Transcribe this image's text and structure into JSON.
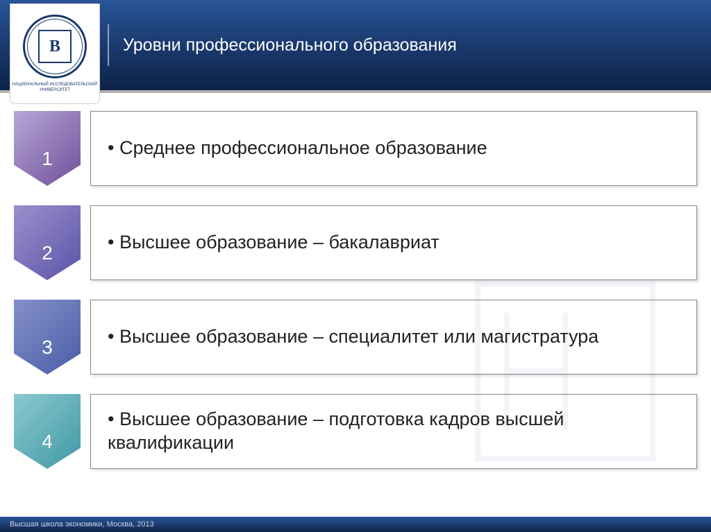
{
  "header": {
    "title": "Уровни профессионального образования"
  },
  "logo": {
    "initials": "В",
    "line1": "НАЦИОНАЛЬНЫЙ ИССЛЕДОВАТЕЛЬСКИЙ",
    "line2": "УНИВЕРСИТЕТ"
  },
  "items": [
    {
      "num": "1",
      "text": "Среднее профессиональное образование"
    },
    {
      "num": "2",
      "text": "Высшее образование – бакалавриат"
    },
    {
      "num": "3",
      "text": "Высшее образование – специалитет или магистратура"
    },
    {
      "num": "4",
      "text": "Высшее образование – подготовка кадров высшей квалификации"
    }
  ],
  "footer": {
    "text": "Высшая школа экономики, Москва, 2013"
  }
}
